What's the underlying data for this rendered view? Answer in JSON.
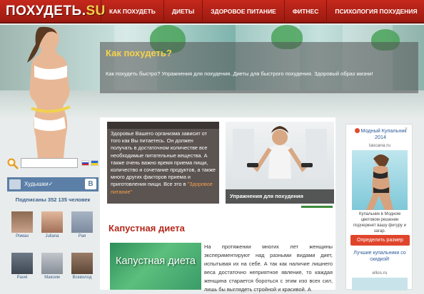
{
  "header": {
    "logo_main": "ПОХУДЕТЬ.",
    "logo_su": "SU",
    "nav": [
      "КАК ПОХУДЕТЬ",
      "ДИЕТЫ",
      "ЗДОРОВОЕ ПИТАНИЕ",
      "ФИТНЕС",
      "ПСИХОЛОГИЯ ПОХУДЕНИЯ"
    ]
  },
  "hero": {
    "title": "Как похудеть?",
    "text": "Как похудеть быстро? Упражнения для похудения. Диеты для быстрого похудения. Здоровый образ жизни!"
  },
  "sidebar": {
    "vk_name": "Худышки✓",
    "vk_logo": "В",
    "subscribers": "Подписаны 352 135 человек",
    "members": [
      "Роман",
      "Juliana",
      "Рая",
      "Pavel",
      "Максим",
      "Всеволод"
    ]
  },
  "cards": {
    "dark_text": "Здоровье Вашего организма зависит от того как Вы питаетесь. Он должен получать в достаточном количестве все необходимые питательные вещества. А также очень важно время приема пищи, количество и сочетание продуктов, а также много других факторов приема и приготовления пищи. Все это в",
    "dark_link": "\"Здоровое питание\"",
    "photo_caption": "Упражнения для похудения"
  },
  "article": {
    "title": "Капустная диета",
    "image_text": "Капустная диета",
    "text": "На протяжении многих лет женщины экспериментируют над разными видами диет, испытывая их на себе. А так как наличие лишнего веса достаточно неприятное явление, то каждая женщина старается бороться с этим изо всех сил, лишь бы выглядеть стройной и красивой. А"
  },
  "ad": {
    "title": "Модный Купальник 2014",
    "domain": "lascana.ru",
    "desc": "Купальник в Модном цветовом решении подчеркнет вашу фигуру и загар.",
    "button": "Определить размер",
    "sub_title": "Лучшие купальники со скидкой!",
    "sub_domain": "ellos.ru",
    "close": "×"
  },
  "colors": {
    "header": "#b1231a",
    "accent": "#f6d34a",
    "title_red": "#b5281b",
    "vk": "#5b7fa6",
    "ad_button": "#e0452c"
  }
}
